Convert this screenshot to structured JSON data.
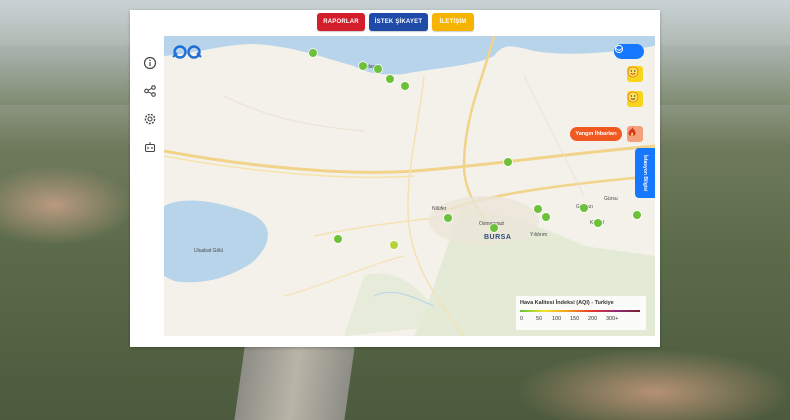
{
  "nav": {
    "buttons": [
      {
        "label": "RAPORLAR",
        "color": "#d21f2b"
      },
      {
        "label": "İSTEK ŞİKAYET",
        "color": "#1f4aa8"
      },
      {
        "label": "İLETİŞİM",
        "color": "#f6b400"
      }
    ]
  },
  "sidebar": {
    "icons": [
      "info-icon",
      "share-icon",
      "settings-icon",
      "robot-icon"
    ]
  },
  "map": {
    "place_labels": [
      {
        "text": "Mudanya"
      },
      {
        "text": "Nilüfer"
      },
      {
        "text": "Osmangazi"
      },
      {
        "text": "BURSA"
      },
      {
        "text": "Yıldırım"
      },
      {
        "text": "Gölyazı"
      },
      {
        "text": "Kestel"
      },
      {
        "text": "Gürsu"
      },
      {
        "text": "Uluabat Gölü"
      }
    ],
    "station_count": 17,
    "colors": {
      "good": "#6cc13a",
      "moderate": "#b6d23a",
      "water": "#b7d4ea"
    }
  },
  "controls": {
    "layer_icon": "layers-icon",
    "emoji_icons": [
      "happy-face-icon",
      "smile-face-icon"
    ],
    "fire_label": "Yangın İhbarları",
    "fire_icon": "fire-icon",
    "side_tab": "İstasyon Bilgisi"
  },
  "legend": {
    "title": "Hava Kalitesi İndeksi (AQI) - Turkiye",
    "ticks": [
      "0",
      "50",
      "100",
      "150",
      "200",
      "300+"
    ]
  }
}
